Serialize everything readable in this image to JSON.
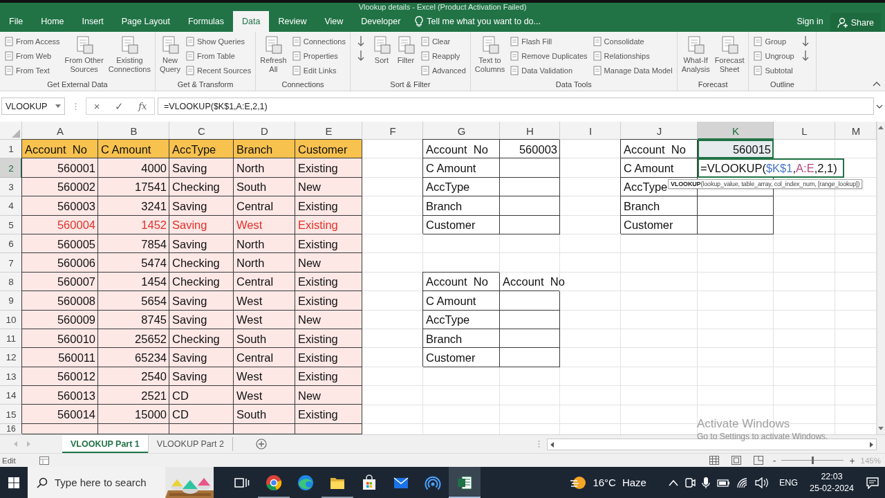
{
  "window": {
    "title": "Vlookup details - Excel (Product Activation Failed)"
  },
  "ribbon_tabs": [
    {
      "label": "File",
      "selected": false
    },
    {
      "label": "Home",
      "selected": false
    },
    {
      "label": "Insert",
      "selected": false
    },
    {
      "label": "Page Layout",
      "selected": false
    },
    {
      "label": "Formulas",
      "selected": false
    },
    {
      "label": "Data",
      "selected": true
    },
    {
      "label": "Review",
      "selected": false
    },
    {
      "label": "View",
      "selected": false
    },
    {
      "label": "Developer",
      "selected": false
    }
  ],
  "tell_me": "Tell me what you want to do...",
  "account": {
    "sign_in": "Sign in",
    "share": "Share"
  },
  "ribbon_groups": [
    {
      "label": "Get External Data",
      "items": [
        {
          "kind": "stack",
          "items": [
            {
              "kind": "button",
              "label": "From Access"
            },
            {
              "kind": "button",
              "label": "From Web"
            },
            {
              "kind": "button",
              "label": "From Text"
            }
          ]
        },
        {
          "kind": "large",
          "label": "From Other\nSources"
        },
        {
          "kind": "large",
          "label": "Existing\nConnections"
        }
      ]
    },
    {
      "label": "Get & Transform",
      "items": [
        {
          "kind": "large",
          "label": "New\nQuery"
        },
        {
          "kind": "stack",
          "items": [
            {
              "kind": "button",
              "label": "Show Queries"
            },
            {
              "kind": "button",
              "label": "From Table"
            },
            {
              "kind": "button",
              "label": "Recent Sources"
            }
          ]
        }
      ]
    },
    {
      "label": "Connections",
      "items": [
        {
          "kind": "large",
          "label": "Refresh\nAll"
        },
        {
          "kind": "stack",
          "items": [
            {
              "kind": "button",
              "label": "Connections"
            },
            {
              "kind": "button",
              "label": "Properties"
            },
            {
              "kind": "button",
              "label": "Edit Links"
            }
          ]
        }
      ]
    },
    {
      "label": "Sort & Filter",
      "items": [
        {
          "kind": "stack",
          "items": [
            {
              "kind": "icon"
            },
            {
              "kind": "icon"
            }
          ]
        },
        {
          "kind": "large",
          "label": "Sort"
        },
        {
          "kind": "large",
          "label": "Filter"
        },
        {
          "kind": "stack",
          "items": [
            {
              "kind": "button",
              "label": "Clear"
            },
            {
              "kind": "button",
              "label": "Reapply"
            },
            {
              "kind": "button",
              "label": "Advanced"
            }
          ]
        }
      ]
    },
    {
      "label": "Data Tools",
      "items": [
        {
          "kind": "large",
          "label": "Text to\nColumns"
        },
        {
          "kind": "stack",
          "items": [
            {
              "kind": "button",
              "label": "Flash Fill"
            },
            {
              "kind": "button",
              "label": "Remove Duplicates"
            },
            {
              "kind": "button",
              "label": "Data Validation"
            }
          ]
        },
        {
          "kind": "stack",
          "items": [
            {
              "kind": "button",
              "label": "Consolidate"
            },
            {
              "kind": "button",
              "label": "Relationships"
            },
            {
              "kind": "button",
              "label": "Manage Data Model"
            }
          ]
        }
      ]
    },
    {
      "label": "Forecast",
      "items": [
        {
          "kind": "large",
          "label": "What-If\nAnalysis"
        },
        {
          "kind": "large",
          "label": "Forecast\nSheet"
        }
      ]
    },
    {
      "label": "Outline",
      "items": [
        {
          "kind": "stack",
          "items": [
            {
              "kind": "button",
              "label": "Group"
            },
            {
              "kind": "button",
              "label": "Ungroup"
            },
            {
              "kind": "button",
              "label": "Subtotal"
            }
          ]
        },
        {
          "kind": "stack",
          "items": [
            {
              "kind": "icon"
            },
            {
              "kind": "icon"
            }
          ]
        }
      ]
    }
  ],
  "formula_bar": {
    "name_box": "VLOOKUP",
    "cancel": "×",
    "enter": "✓",
    "function": "fx",
    "formula": "=VLOOKUP($K$1,A:E,2,1)"
  },
  "sheet": {
    "columns": [
      {
        "label": "A",
        "selected": false
      },
      {
        "label": "B",
        "selected": false
      },
      {
        "label": "C",
        "selected": false
      },
      {
        "label": "D",
        "selected": false
      },
      {
        "label": "E",
        "selected": false
      },
      {
        "label": "F",
        "selected": false
      },
      {
        "label": "G",
        "selected": false
      },
      {
        "label": "H",
        "selected": false
      },
      {
        "label": "I",
        "selected": false
      },
      {
        "label": "J",
        "selected": false
      },
      {
        "label": "K",
        "selected": true
      },
      {
        "label": "L",
        "selected": false
      },
      {
        "label": "M",
        "selected": false
      }
    ],
    "rows": [
      {
        "number": "1",
        "selected": false,
        "cells": [
          {
            "kind": "header",
            "text": "Account  No"
          },
          {
            "kind": "header",
            "text": "C Amount"
          },
          {
            "kind": "header",
            "text": "AccType"
          },
          {
            "kind": "header",
            "text": "Branch"
          },
          {
            "kind": "header",
            "text": "Customer"
          },
          "",
          {
            "kind": "label",
            "text": "Account  No"
          },
          {
            "kind": "label-number",
            "text": "560003"
          },
          "",
          {
            "kind": "label",
            "text": "Account  No"
          },
          {
            "kind": "active",
            "text": "560015"
          }
        ]
      },
      {
        "number": "2",
        "selected": true,
        "cells": [
          {
            "kind": "number",
            "text": "560001"
          },
          {
            "kind": "number",
            "text": "4000"
          },
          {
            "kind": "data",
            "text": "Saving"
          },
          {
            "kind": "data",
            "text": "North"
          },
          {
            "kind": "data",
            "text": "Existing"
          },
          "",
          {
            "kind": "label",
            "text": "C Amount"
          },
          {
            "kind": "box"
          },
          "",
          {
            "kind": "label",
            "text": "C Amount"
          },
          {
            "kind": "editing",
            "parts": [
              {
                "text": "=VLOOKUP("
              },
              {
                "text": "$K$1",
                "color": "#4a78c8"
              },
              {
                "text": ","
              },
              {
                "text": "A:E",
                "color": "#b8467e"
              },
              {
                "text": ",2,1)"
              }
            ]
          }
        ]
      },
      {
        "number": "3",
        "selected": false,
        "cells": [
          {
            "kind": "number",
            "text": "560002"
          },
          {
            "kind": "number",
            "text": "17541"
          },
          {
            "kind": "data",
            "text": "Checking"
          },
          {
            "kind": "data",
            "text": "South"
          },
          {
            "kind": "data",
            "text": "New"
          },
          "",
          {
            "kind": "label",
            "text": "AccType"
          },
          {
            "kind": "box"
          },
          "",
          {
            "kind": "label",
            "text": "AccType"
          },
          {
            "kind": "box"
          }
        ]
      },
      {
        "number": "4",
        "selected": false,
        "cells": [
          {
            "kind": "number",
            "text": "560003"
          },
          {
            "kind": "number",
            "text": "3241"
          },
          {
            "kind": "data",
            "text": "Saving"
          },
          {
            "kind": "data",
            "text": "Central"
          },
          {
            "kind": "data",
            "text": "Existing"
          },
          "",
          {
            "kind": "label",
            "text": "Branch"
          },
          {
            "kind": "box"
          },
          "",
          {
            "kind": "label",
            "text": "Branch"
          },
          {
            "kind": "box"
          }
        ]
      },
      {
        "number": "5",
        "selected": false,
        "cells": [
          {
            "kind": "alert-number",
            "text": "560004"
          },
          {
            "kind": "alert-number",
            "text": "1452"
          },
          {
            "kind": "alert",
            "text": "Saving"
          },
          {
            "kind": "alert",
            "text": "West"
          },
          {
            "kind": "alert",
            "text": "Existing"
          },
          "",
          {
            "kind": "label",
            "text": "Customer"
          },
          {
            "kind": "box"
          },
          "",
          {
            "kind": "label",
            "text": "Customer"
          },
          {
            "kind": "box"
          }
        ]
      },
      {
        "number": "6",
        "selected": false,
        "cells": [
          {
            "kind": "number",
            "text": "560005"
          },
          {
            "kind": "number",
            "text": "7854"
          },
          {
            "kind": "data",
            "text": "Saving"
          },
          {
            "kind": "data",
            "text": "North"
          },
          {
            "kind": "data",
            "text": "Existing"
          }
        ]
      },
      {
        "number": "7",
        "selected": false,
        "cells": [
          {
            "kind": "number",
            "text": "560006"
          },
          {
            "kind": "number",
            "text": "5474"
          },
          {
            "kind": "data",
            "text": "Checking"
          },
          {
            "kind": "data",
            "text": "North"
          },
          {
            "kind": "data",
            "text": "New"
          }
        ]
      },
      {
        "number": "8",
        "selected": false,
        "cells": [
          {
            "kind": "number",
            "text": "560007"
          },
          {
            "kind": "number",
            "text": "1454"
          },
          {
            "kind": "data",
            "text": "Checking"
          },
          {
            "kind": "data",
            "text": "Central"
          },
          {
            "kind": "data",
            "text": "Existing"
          },
          "",
          {
            "kind": "label",
            "text": "Account  No"
          },
          {
            "kind": "plain",
            "text": "Account  No"
          }
        ]
      },
      {
        "number": "9",
        "selected": false,
        "cells": [
          {
            "kind": "number",
            "text": "560008"
          },
          {
            "kind": "number",
            "text": "5654"
          },
          {
            "kind": "data",
            "text": "Saving"
          },
          {
            "kind": "data",
            "text": "West"
          },
          {
            "kind": "data",
            "text": "Existing"
          },
          "",
          {
            "kind": "label",
            "text": "C Amount"
          },
          {
            "kind": "box"
          }
        ]
      },
      {
        "number": "10",
        "selected": false,
        "cells": [
          {
            "kind": "number",
            "text": "560009"
          },
          {
            "kind": "number",
            "text": "8745"
          },
          {
            "kind": "data",
            "text": "Saving"
          },
          {
            "kind": "data",
            "text": "West"
          },
          {
            "kind": "data",
            "text": "New"
          },
          "",
          {
            "kind": "label",
            "text": "AccType"
          },
          {
            "kind": "box"
          }
        ]
      },
      {
        "number": "11",
        "selected": false,
        "cells": [
          {
            "kind": "number",
            "text": "560010"
          },
          {
            "kind": "number",
            "text": "25652"
          },
          {
            "kind": "data",
            "text": "Checking"
          },
          {
            "kind": "data",
            "text": "South"
          },
          {
            "kind": "data",
            "text": "Existing"
          },
          "",
          {
            "kind": "label",
            "text": "Branch"
          },
          {
            "kind": "box"
          }
        ]
      },
      {
        "number": "12",
        "selected": false,
        "cells": [
          {
            "kind": "number",
            "text": "560011"
          },
          {
            "kind": "number",
            "text": "65234"
          },
          {
            "kind": "data",
            "text": "Saving"
          },
          {
            "kind": "data",
            "text": "Central"
          },
          {
            "kind": "data",
            "text": "Existing"
          },
          "",
          {
            "kind": "label",
            "text": "Customer"
          },
          {
            "kind": "box"
          }
        ]
      },
      {
        "number": "13",
        "selected": false,
        "cells": [
          {
            "kind": "number",
            "text": "560012"
          },
          {
            "kind": "number",
            "text": "2540"
          },
          {
            "kind": "data",
            "text": "Saving"
          },
          {
            "kind": "data",
            "text": "West"
          },
          {
            "kind": "data",
            "text": "Existing"
          }
        ]
      },
      {
        "number": "14",
        "selected": false,
        "cells": [
          {
            "kind": "number",
            "text": "560013"
          },
          {
            "kind": "number",
            "text": "2521"
          },
          {
            "kind": "data",
            "text": "CD"
          },
          {
            "kind": "data",
            "text": "West"
          },
          {
            "kind": "data",
            "text": "New"
          }
        ]
      },
      {
        "number": "15",
        "selected": false,
        "cells": [
          {
            "kind": "number",
            "text": "560014"
          },
          {
            "kind": "number",
            "text": "15000"
          },
          {
            "kind": "data",
            "text": "CD"
          },
          {
            "kind": "data",
            "text": "South"
          },
          {
            "kind": "data",
            "text": "Existing"
          }
        ]
      },
      {
        "number": "16",
        "selected": false,
        "cells": [
          {
            "kind": "data"
          },
          {
            "kind": "data"
          },
          {
            "kind": "data"
          },
          {
            "kind": "data"
          },
          {
            "kind": "data"
          }
        ]
      }
    ],
    "tooltip": "**VLOOKUP**(lookup_value, table_array, col_index_num, [range_lookup])"
  },
  "sheet_tabs": [
    {
      "label": "VLOOKUP Part 1",
      "selected": true
    },
    {
      "label": "VLOOKUP Part 2",
      "selected": false
    }
  ],
  "status_bar": {
    "mode": "Edit",
    "zoom_out": "-",
    "zoom_in": "+",
    "zoom_slider": {
      "level": 0.5
    },
    "zoom": "145%"
  },
  "activation_notice": {
    "title": "Activate Windows",
    "message": "Go to Settings to activate Windows."
  },
  "taskbar": {
    "search": {
      "placeholder": "Type here to search"
    },
    "apps": [
      {
        "kind": "task-view",
        "selected": false,
        "running": false
      },
      {
        "kind": "chrome",
        "selected": false,
        "running": true
      },
      {
        "kind": "edge",
        "selected": false,
        "running": false
      },
      {
        "kind": "explorer",
        "selected": false,
        "running": true
      },
      {
        "kind": "store",
        "selected": false,
        "running": false
      },
      {
        "kind": "mail",
        "selected": false,
        "running": false
      },
      {
        "kind": "signal",
        "selected": false,
        "running": false
      },
      {
        "kind": "excel",
        "selected": true,
        "running": true
      }
    ],
    "weather": {
      "temperature": "16°C",
      "condition": "Haze"
    },
    "language": "ENG",
    "time": "22:03",
    "date": "25-02-2024"
  }
}
